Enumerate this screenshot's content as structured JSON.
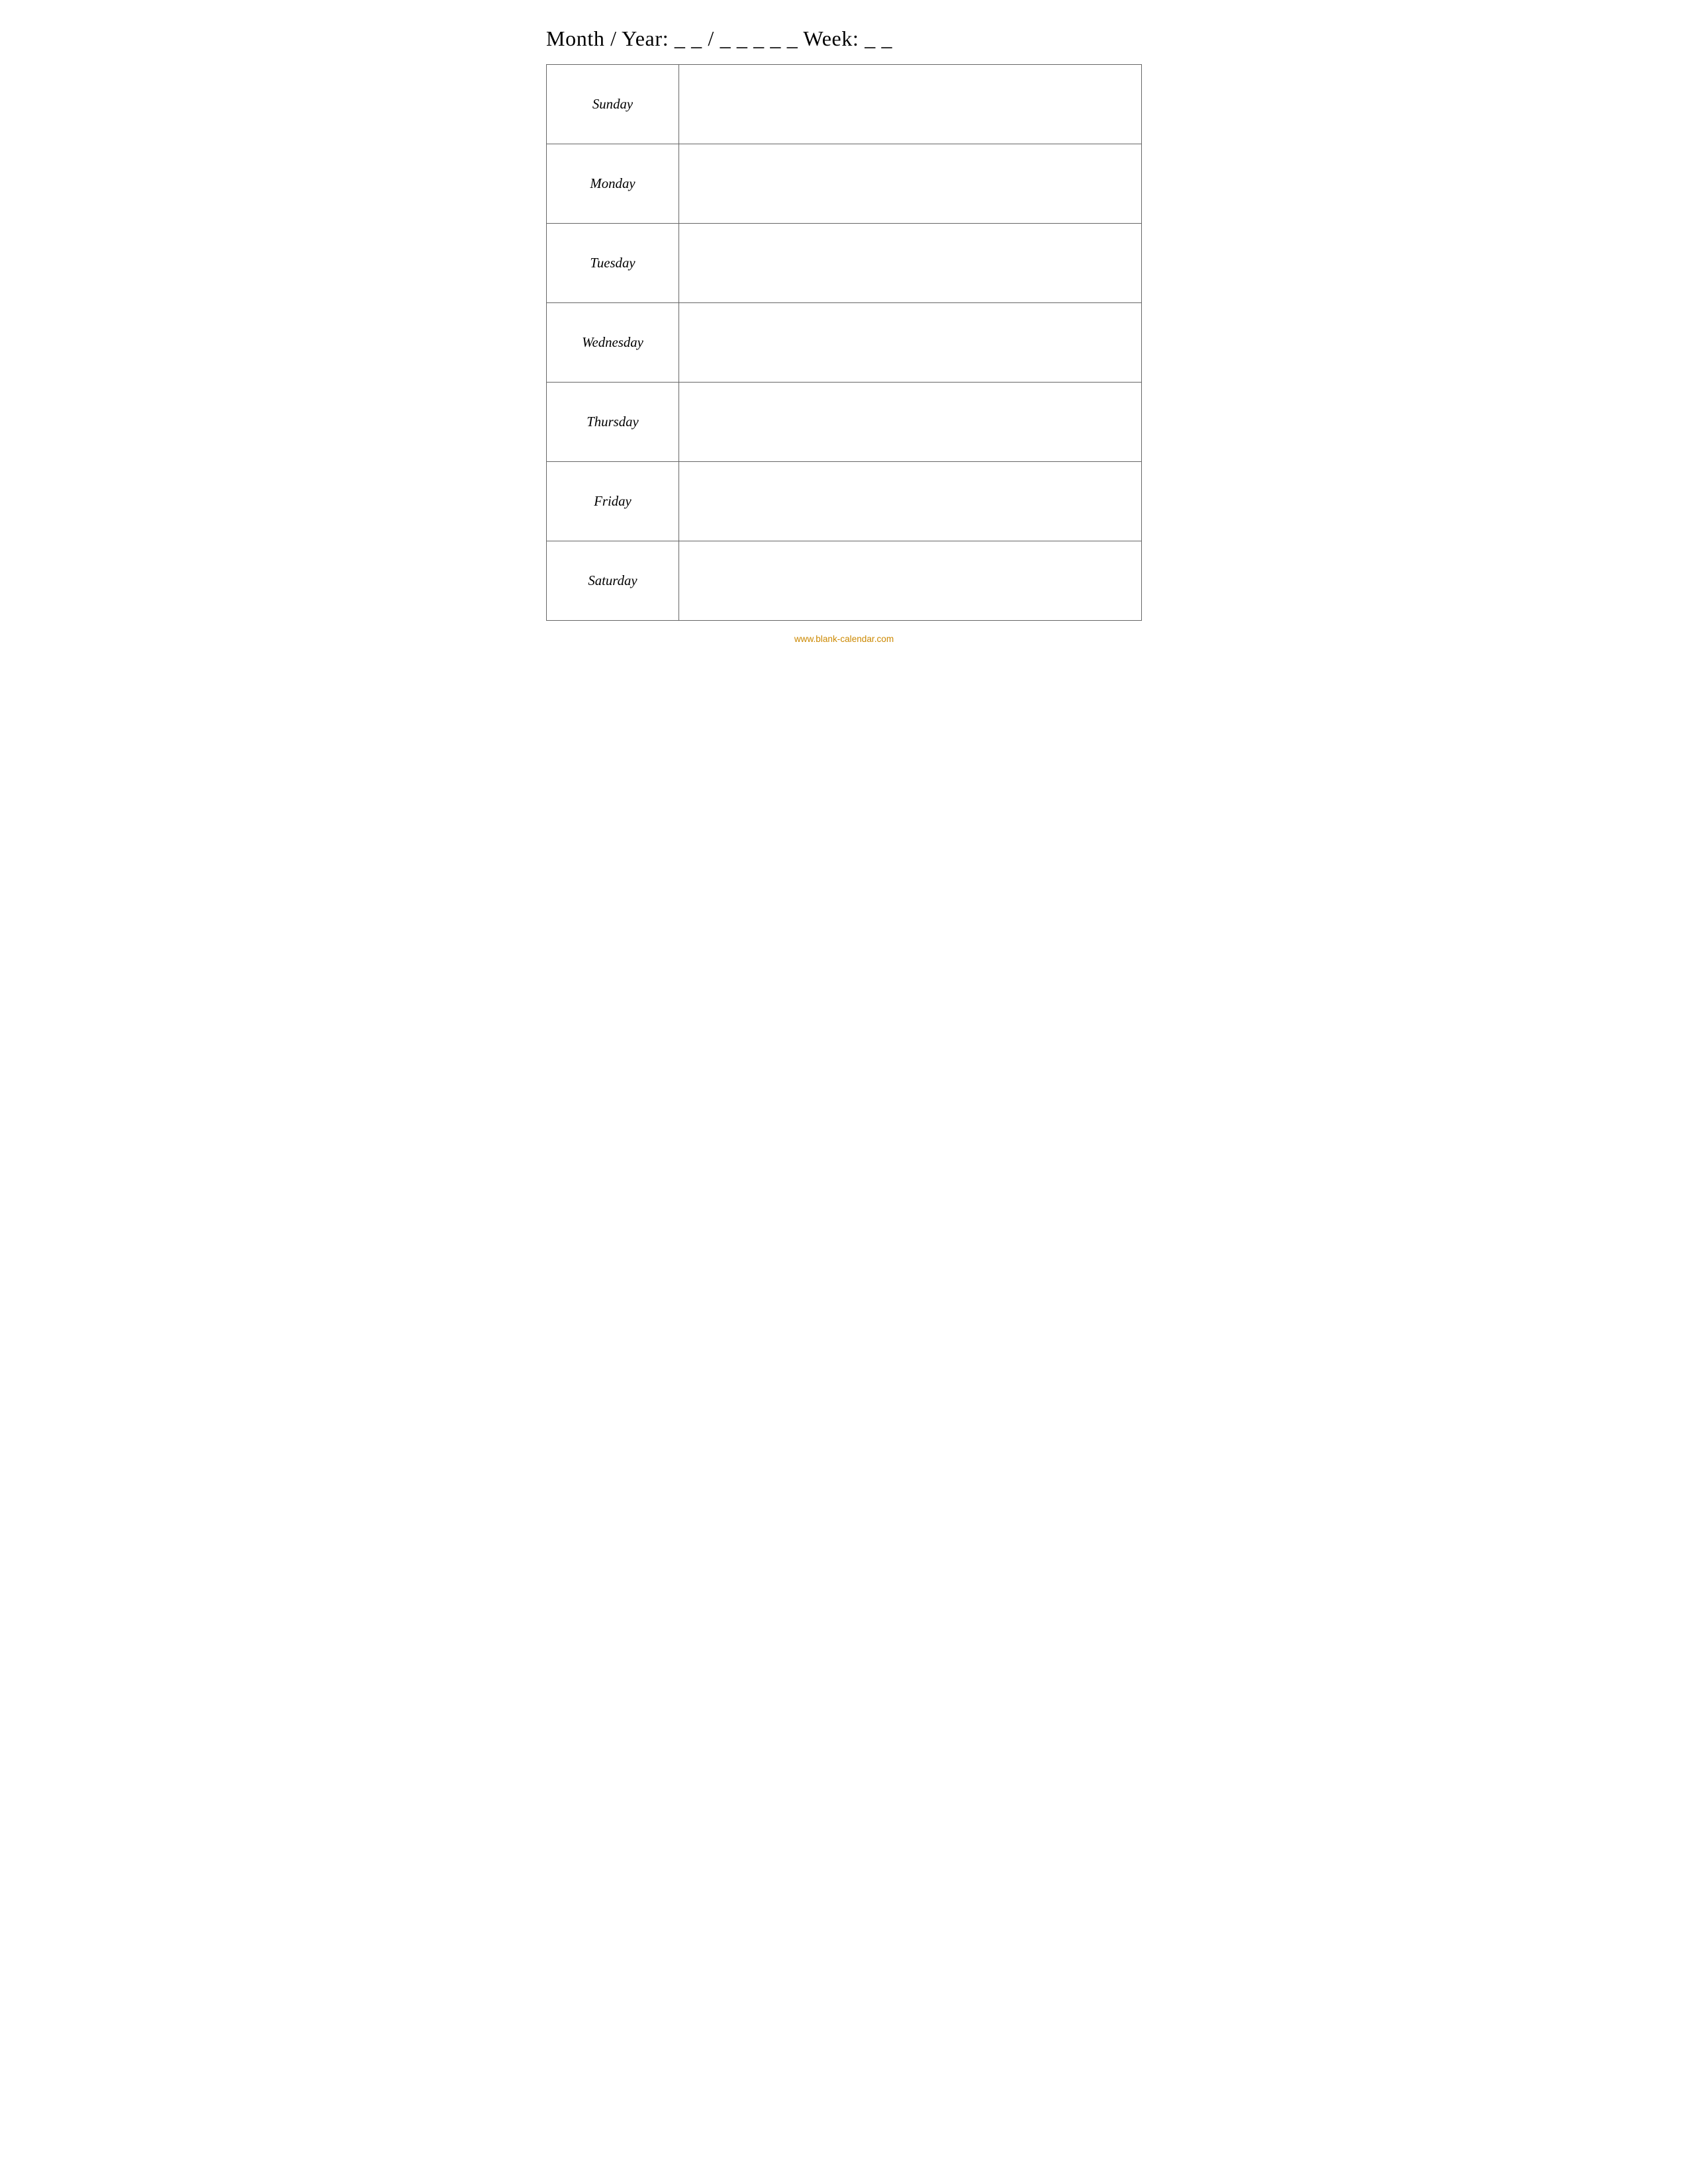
{
  "header": {
    "label": "Month / Year: _ _ / _ _ _ _ _ Week: _ _"
  },
  "days": [
    {
      "name": "Sunday"
    },
    {
      "name": "Monday"
    },
    {
      "name": "Tuesday"
    },
    {
      "name": "Wednesday"
    },
    {
      "name": "Thursday"
    },
    {
      "name": "Friday"
    },
    {
      "name": "Saturday"
    }
  ],
  "footer": {
    "url": "www.blank-calendar.com"
  }
}
